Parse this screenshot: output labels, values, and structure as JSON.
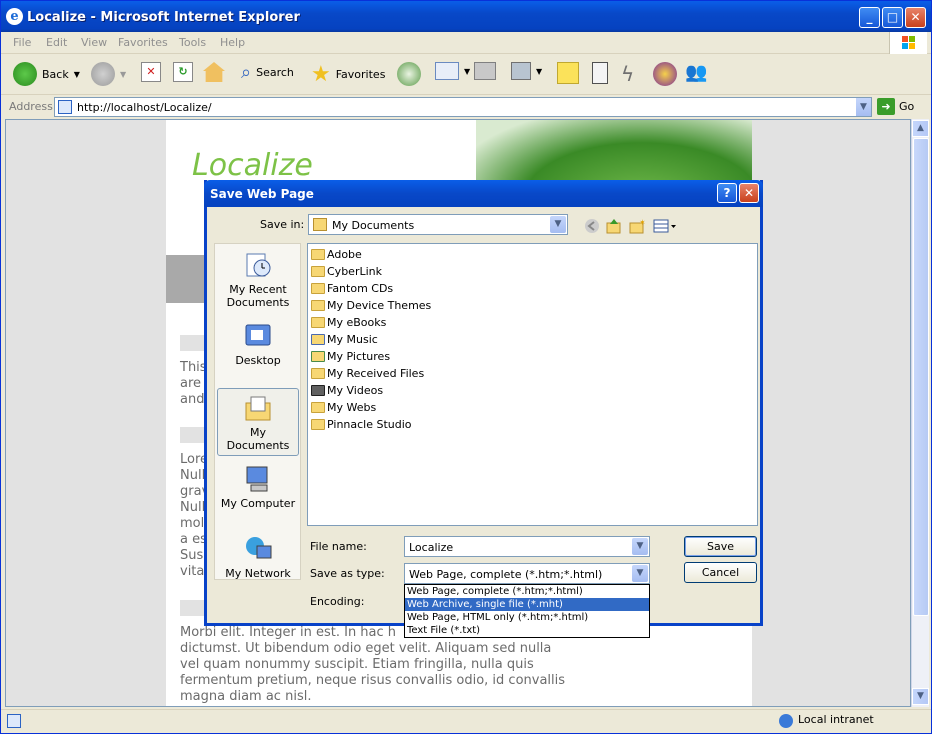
{
  "window": {
    "title": "Localize - Microsoft Internet Explorer",
    "controls": [
      "minimize",
      "maximize",
      "close"
    ]
  },
  "menu": [
    "File",
    "Edit",
    "View",
    "Favorites",
    "Tools",
    "Help"
  ],
  "toolbar": {
    "back_label": "Back",
    "search_label": "Search",
    "favorites_label": "Favorites"
  },
  "address": {
    "label": "Address",
    "url": "http://localhost/Localize/",
    "go_label": "Go"
  },
  "page": {
    "site_title": "Localize",
    "para1": [
      "This",
      "are",
      "and"
    ],
    "para2": [
      "Lore",
      "Nulla",
      "grav",
      "Nulla",
      "moll",
      "a es",
      "Sus",
      "vita"
    ],
    "para3": [
      "Morbi elit. Integer in est. In hac h",
      "dictumst. Ut bibendum odio eget velit. Aliquam sed nulla",
      "vel quam nonummy suscipit. Etiam fringilla, nulla quis",
      "fermentum pretium, neque risus convallis odio, id convallis",
      "magna diam ac nisl."
    ]
  },
  "status": {
    "zone": "Local intranet"
  },
  "dialog": {
    "title": "Save Web Page",
    "help_label": "?",
    "save_in_label": "Save in:",
    "save_in_value": "My Documents",
    "places": [
      {
        "label": "My Recent Documents"
      },
      {
        "label": "Desktop"
      },
      {
        "label": "My Documents"
      },
      {
        "label": "My Computer"
      },
      {
        "label": "My Network"
      }
    ],
    "files": [
      "Adobe",
      "CyberLink",
      "Fantom CDs",
      "My Device Themes",
      "My eBooks",
      "My Music",
      "My Pictures",
      "My Received Files",
      "My Videos",
      "My Webs",
      "Pinnacle Studio"
    ],
    "file_name_label": "File name:",
    "file_name_value": "Localize",
    "save_as_type_label": "Save as type:",
    "save_as_type_value": "Web Page, complete (*.htm;*.html)",
    "encoding_label": "Encoding:",
    "save_label": "Save",
    "cancel_label": "Cancel",
    "type_options": [
      "Web Page, complete (*.htm;*.html)",
      "Web Archive, single file (*.mht)",
      "Web Page, HTML only (*.htm;*.html)",
      "Text File (*.txt)"
    ],
    "selected_option_index": 1
  },
  "colors": {
    "title_blue": "#0a5ee8",
    "site_green": "#7dc247",
    "selection": "#316ac5"
  }
}
